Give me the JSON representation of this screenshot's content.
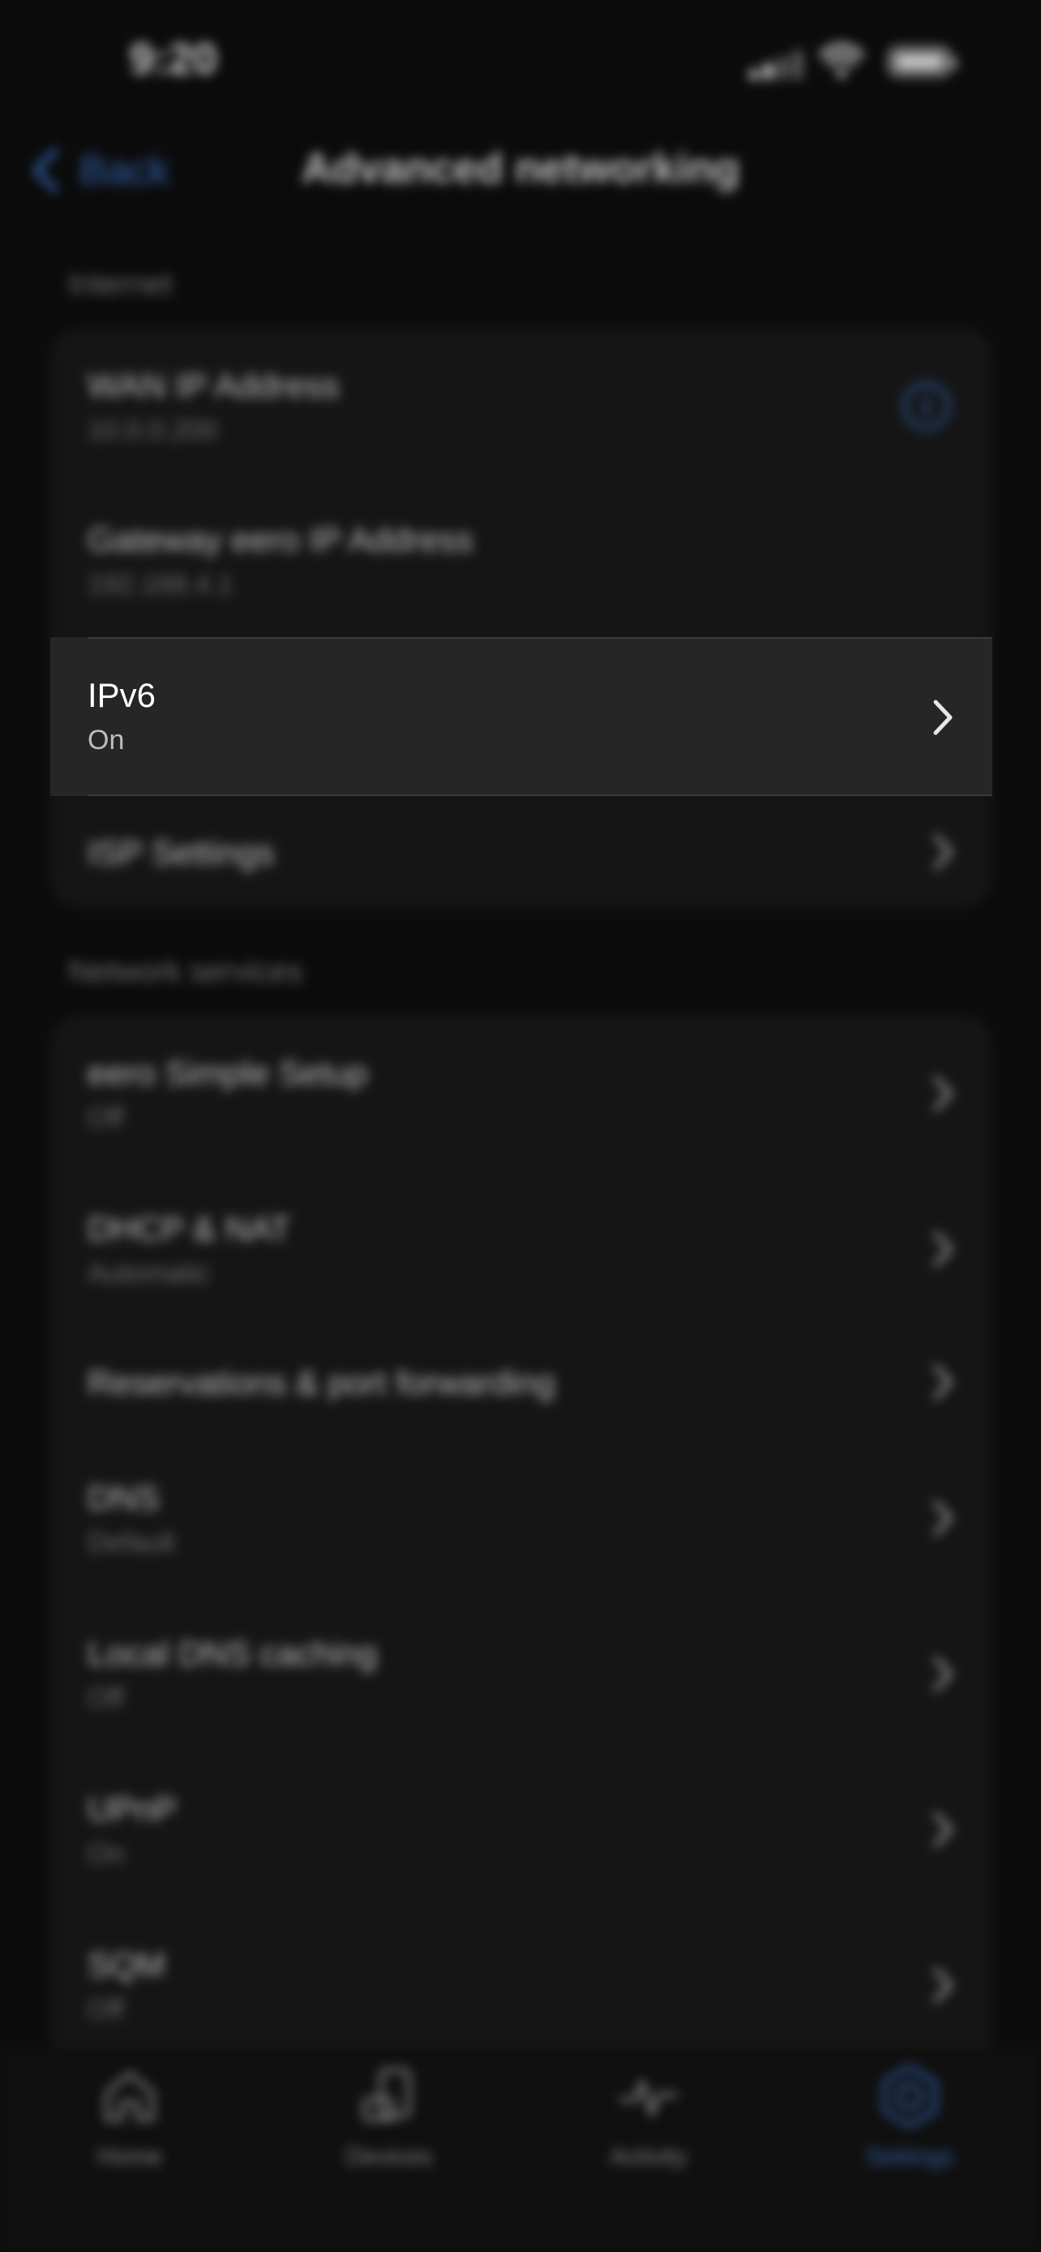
{
  "status": {
    "time": "9:20"
  },
  "nav": {
    "back_label": "Back",
    "title": "Advanced networking"
  },
  "sections": [
    {
      "label": "Internet",
      "rows": [
        {
          "title": "WAN IP Address",
          "subtitle": "10.0.0.200",
          "accessory": "info-icon"
        },
        {
          "title": "Gateway eero IP Address",
          "subtitle": "192.168.4.1",
          "accessory": "none"
        },
        {
          "title": "IPv6",
          "subtitle": "On",
          "accessory": "chevron-right-icon",
          "highlighted": true
        },
        {
          "title": "ISP Settings",
          "subtitle": "",
          "accessory": "chevron-right-icon"
        }
      ]
    },
    {
      "label": "Network services",
      "rows": [
        {
          "title": "eero Simple Setup",
          "subtitle": "Off",
          "accessory": "chevron-right-icon"
        },
        {
          "title": "DHCP & NAT",
          "subtitle": "Automatic",
          "accessory": "chevron-right-icon"
        },
        {
          "title": "Reservations & port forwarding",
          "subtitle": "",
          "accessory": "chevron-right-icon"
        },
        {
          "title": "DNS",
          "subtitle": "Default",
          "accessory": "chevron-right-icon"
        },
        {
          "title": "Local DNS caching",
          "subtitle": "Off",
          "accessory": "chevron-right-icon"
        },
        {
          "title": "UPnP",
          "subtitle": "On",
          "accessory": "chevron-right-icon"
        },
        {
          "title": "SQM",
          "subtitle": "Off",
          "accessory": "chevron-right-icon"
        }
      ]
    }
  ],
  "tabbar": {
    "tabs": [
      {
        "label": "Home",
        "icon": "house-icon",
        "active": false
      },
      {
        "label": "Devices",
        "icon": "devices-icon",
        "active": false
      },
      {
        "label": "Activity",
        "icon": "activity-icon",
        "active": false
      },
      {
        "label": "Settings",
        "icon": "gear-icon",
        "active": true
      }
    ]
  },
  "colors": {
    "accent": "#3f7bd8",
    "background": "#0b0b0b",
    "card": "#1b1b1b"
  }
}
